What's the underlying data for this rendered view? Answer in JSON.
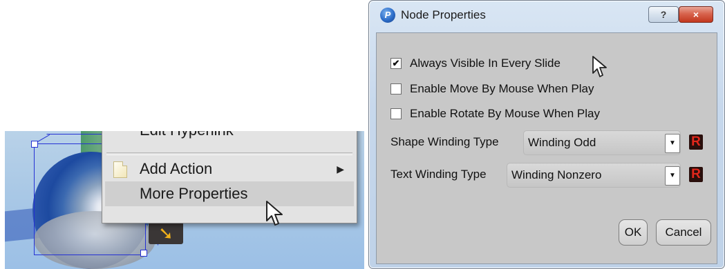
{
  "context_menu": {
    "partial_item_label": "Edit Hyperlink",
    "items": [
      {
        "label": "Add Action",
        "icon": "document-icon",
        "submenu": true
      },
      {
        "label": "More Properties",
        "highlighted": true
      }
    ]
  },
  "dialog": {
    "title": "Node Properties",
    "help_label": "?",
    "close_label": "×",
    "checkboxes": [
      {
        "label": "Always Visible In Every Slide",
        "checked": true
      },
      {
        "label": "Enable Move By Mouse When Play",
        "checked": false
      },
      {
        "label": "Enable Rotate By Mouse When Play",
        "checked": false
      }
    ],
    "shape_winding": {
      "label": "Shape Winding Type",
      "value": "Winding Odd",
      "reset_label": "R"
    },
    "text_winding": {
      "label": "Text Winding Type",
      "value": "Winding Nonzero",
      "reset_label": "R"
    },
    "ok_label": "OK",
    "cancel_label": "Cancel"
  },
  "colors": {
    "reset_red": "#e3271b",
    "close_button": "#c2371e",
    "menu_background": "#e3e3e3",
    "dialog_client": "#c8c8c8"
  }
}
